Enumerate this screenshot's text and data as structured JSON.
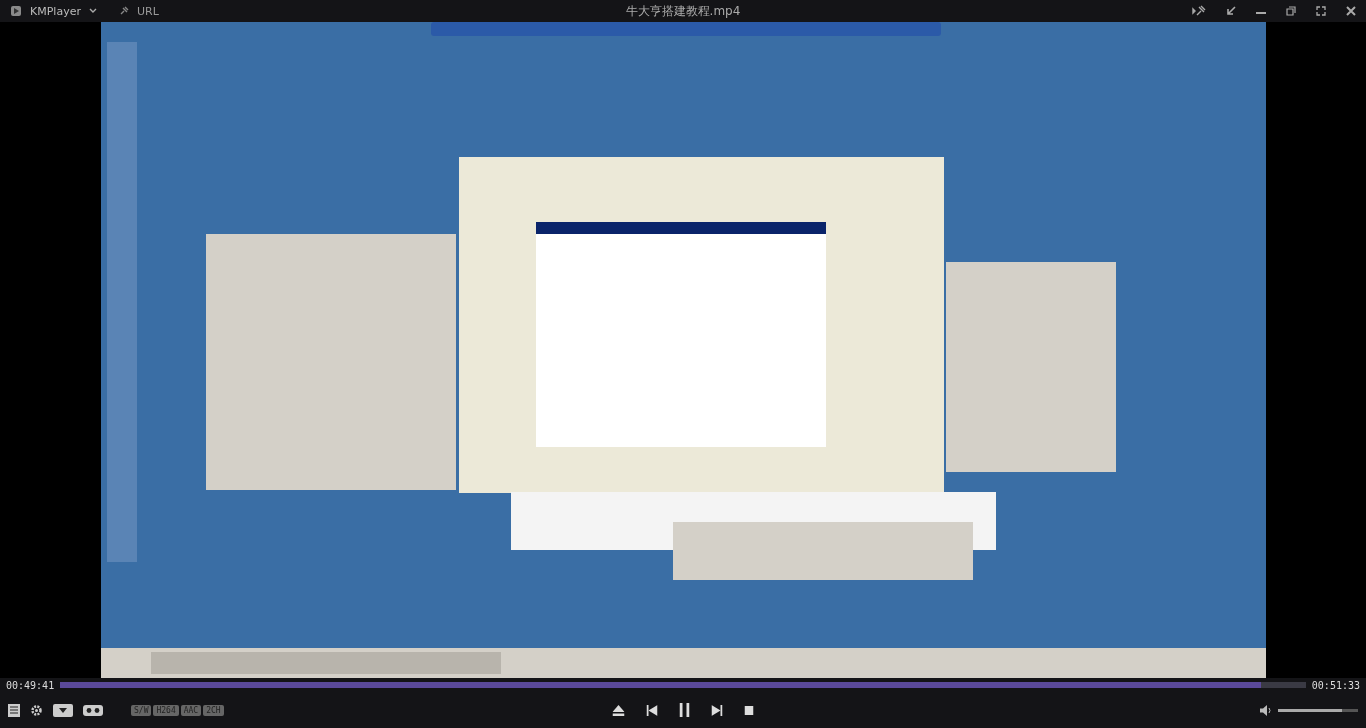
{
  "window": {
    "app_name": "KMPlayer",
    "url_label": "URL",
    "title": "牛大亨搭建教程.mp4"
  },
  "seek": {
    "elapsed": "00:49:41",
    "total": "00:51:33",
    "level": 0.964
  },
  "codec_tags": [
    "S/W",
    "H264",
    "AAC",
    "2CH"
  ],
  "volume": {
    "level": 0.8
  }
}
